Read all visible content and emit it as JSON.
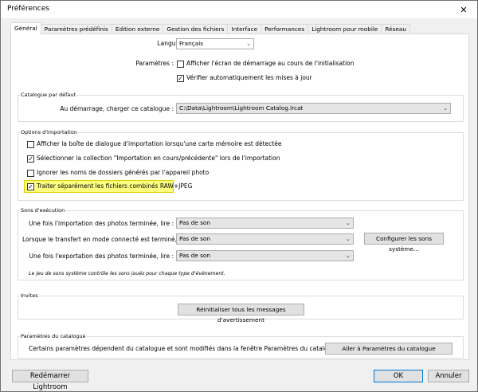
{
  "window": {
    "title": "Préférences",
    "close_glyph": "✕"
  },
  "tabs": [
    {
      "label": "Général",
      "active": true
    },
    {
      "label": "Paramètres prédéfinis",
      "active": false
    },
    {
      "label": "Edition externe",
      "active": false
    },
    {
      "label": "Gestion des fichiers",
      "active": false
    },
    {
      "label": "Interface",
      "active": false
    },
    {
      "label": "Performances",
      "active": false
    },
    {
      "label": "Lightroom pour mobile",
      "active": false
    },
    {
      "label": "Réseau",
      "active": false
    }
  ],
  "general": {
    "language_label": "Langue :",
    "language_value": "Français",
    "params_label": "Paramètres :",
    "show_splash": {
      "label": "Afficher l'écran de démarrage au cours de l'initialisation",
      "checked": false
    },
    "check_updates": {
      "label": "Vérifier automatiquement les mises à jour",
      "checked": true
    }
  },
  "catalog": {
    "group_title": "Catalogue par défaut",
    "startup_label": "Au démarrage, charger ce catalogue :",
    "startup_value": "C:\\Data\\Lightroom\\Lightroom Catalog.lrcat"
  },
  "import": {
    "group_title": "Options d'importation",
    "options": [
      {
        "label": "Afficher la boîte de dialogue d'importation lorsqu'une carte mémoire est détectée",
        "checked": false
      },
      {
        "label": "Sélectionner la collection \"Importation en cours/précédente\" lors de l'importation",
        "checked": true
      },
      {
        "label": "Ignorer les noms de dossiers générés par l'appareil photo",
        "checked": false
      },
      {
        "label": "Traiter séparément les fichiers combinés RAW+JPEG",
        "checked": true,
        "highlighted": true
      }
    ]
  },
  "sounds": {
    "group_title": "Sons d'exécution",
    "rows": [
      {
        "label": "Une fois l'importation des photos terminée, lire :",
        "value": "Pas de son"
      },
      {
        "label": "Lorsque le transfert en mode connecté est terminé, lire :",
        "value": "Pas de son"
      },
      {
        "label": "Une fois l'exportation des photos terminée, lire :",
        "value": "Pas de son"
      }
    ],
    "configure_button": "Configurer les sons système...",
    "note": "Le jeu de sons système contrôle les sons joués pour chaque type d'évènement."
  },
  "prompts": {
    "group_title": "Invites",
    "reset_button": "Réinitialiser tous les messages d'avertissement"
  },
  "catalog_settings": {
    "group_title": "Paramètres du catalogue",
    "text": "Certains paramètres dépendent du catalogue et sont modifiés dans la fenêtre Paramètres du catalogue.",
    "goto_button": "Aller à Paramètres du catalogue"
  },
  "footer": {
    "restart_button": "Redémarrer Lightroom",
    "ok_button": "OK",
    "cancel_button": "Annuler"
  },
  "glyphs": {
    "check": "✓",
    "dropdown": "⌄"
  }
}
